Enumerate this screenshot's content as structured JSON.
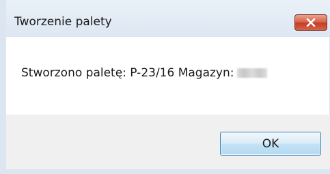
{
  "dialog": {
    "title": "Tworzenie palety",
    "message": "Stworzono paletę: P-23/16 Magazyn:",
    "ok_label": "OK",
    "close_icon": "close-icon"
  },
  "colors": {
    "titlebar": "#e3ecf5",
    "close_button": "#c9452c",
    "footer": "#f0f0f0",
    "ok_border": "#3c7fb1"
  }
}
